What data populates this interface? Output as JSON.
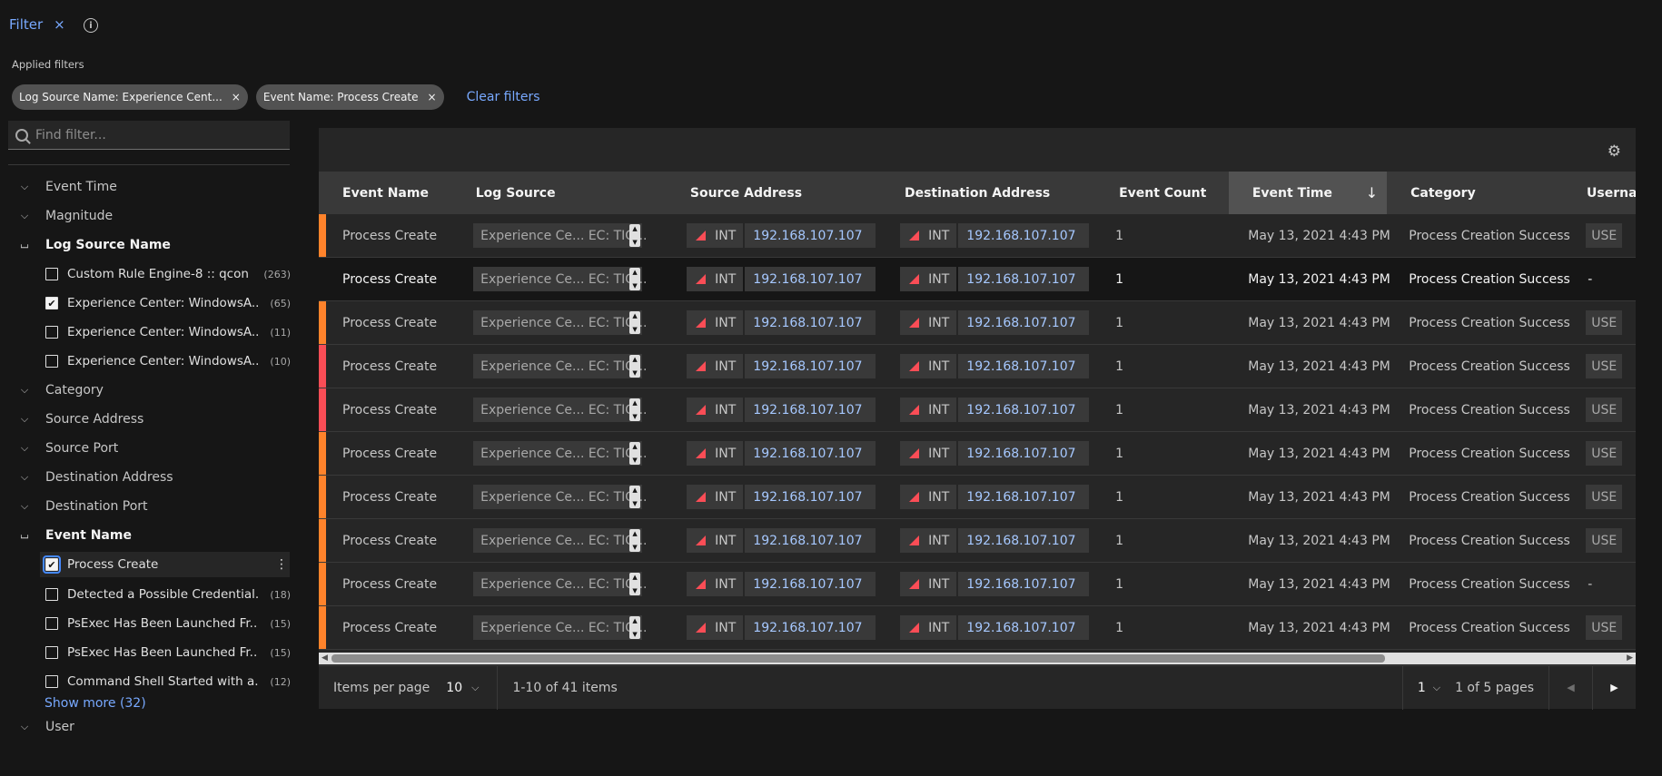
{
  "header": {
    "filter_label": "Filter",
    "close": "×",
    "info": "i"
  },
  "applied": {
    "label": "Applied filters",
    "chips": [
      {
        "label": "Log Source Name: Experience Cent..."
      },
      {
        "label": "Event Name: Process Create"
      }
    ],
    "clear_label": "Clear filters"
  },
  "sidebar": {
    "search_placeholder": "Find filter...",
    "groups": {
      "event_time": "Event Time",
      "magnitude": "Magnitude",
      "log_source_name": "Log Source Name",
      "category": "Category",
      "source_address": "Source Address",
      "source_port": "Source Port",
      "destination_address": "Destination Address",
      "destination_port": "Destination Port",
      "event_name": "Event Name",
      "user": "User"
    },
    "log_source_options": [
      {
        "label": "Custom Rule Engine-8 :: qcon",
        "count": "(263)",
        "checked": false
      },
      {
        "label": "Experience Center: WindowsA...",
        "count": "(65)",
        "checked": true
      },
      {
        "label": "Experience Center: WindowsA...",
        "count": "(11)",
        "checked": false
      },
      {
        "label": "Experience Center: WindowsA...",
        "count": "(10)",
        "checked": false
      }
    ],
    "event_name_options": [
      {
        "label": "Process Create",
        "count": "",
        "checked": true
      },
      {
        "label": "Detected a Possible Credential...",
        "count": "(18)",
        "checked": false
      },
      {
        "label": "PsExec Has Been Launched Fr...",
        "count": "(15)",
        "checked": false
      },
      {
        "label": "PsExec Has Been Launched Fr...",
        "count": "(15)",
        "checked": false
      },
      {
        "label": "Command Shell Started with a...",
        "count": "(12)",
        "checked": false
      }
    ],
    "show_more": "Show more (32)"
  },
  "table": {
    "columns": [
      "Event Name",
      "Log Source",
      "Source Address",
      "Destination Address",
      "Event Count",
      "Event Time",
      "Category",
      "Userna"
    ],
    "rows": [
      {
        "event_name": "Process Create",
        "log_source": "Experience Ce... EC: TIG...",
        "src_tag": "INT",
        "src_ip": "192.168.107.107",
        "dst_tag": "INT",
        "dst_ip": "192.168.107.107",
        "count": "1",
        "time": "May 13, 2021 4:43 PM",
        "category": "Process Creation Success",
        "user": "USE",
        "severity": "#ff832b"
      },
      {
        "event_name": "Process Create",
        "log_source": "Experience Ce... EC: TIG...",
        "src_tag": "INT",
        "src_ip": "192.168.107.107",
        "dst_tag": "INT",
        "dst_ip": "192.168.107.107",
        "count": "1",
        "time": "May 13, 2021 4:43 PM",
        "category": "Process Creation Success",
        "user": "-",
        "severity": "#161616"
      },
      {
        "event_name": "Process Create",
        "log_source": "Experience Ce... EC: TIG...",
        "src_tag": "INT",
        "src_ip": "192.168.107.107",
        "dst_tag": "INT",
        "dst_ip": "192.168.107.107",
        "count": "1",
        "time": "May 13, 2021 4:43 PM",
        "category": "Process Creation Success",
        "user": "USE",
        "severity": "#ff832b"
      },
      {
        "event_name": "Process Create",
        "log_source": "Experience Ce... EC: TIG...",
        "src_tag": "INT",
        "src_ip": "192.168.107.107",
        "dst_tag": "INT",
        "dst_ip": "192.168.107.107",
        "count": "1",
        "time": "May 13, 2021 4:43 PM",
        "category": "Process Creation Success",
        "user": "USE",
        "severity": "#fa4d56"
      },
      {
        "event_name": "Process Create",
        "log_source": "Experience Ce... EC: TIG...",
        "src_tag": "INT",
        "src_ip": "192.168.107.107",
        "dst_tag": "INT",
        "dst_ip": "192.168.107.107",
        "count": "1",
        "time": "May 13, 2021 4:43 PM",
        "category": "Process Creation Success",
        "user": "USE",
        "severity": "#fa4d56"
      },
      {
        "event_name": "Process Create",
        "log_source": "Experience Ce... EC: TIG...",
        "src_tag": "INT",
        "src_ip": "192.168.107.107",
        "dst_tag": "INT",
        "dst_ip": "192.168.107.107",
        "count": "1",
        "time": "May 13, 2021 4:43 PM",
        "category": "Process Creation Success",
        "user": "USE",
        "severity": "#ff832b"
      },
      {
        "event_name": "Process Create",
        "log_source": "Experience Ce... EC: TIG...",
        "src_tag": "INT",
        "src_ip": "192.168.107.107",
        "dst_tag": "INT",
        "dst_ip": "192.168.107.107",
        "count": "1",
        "time": "May 13, 2021 4:43 PM",
        "category": "Process Creation Success",
        "user": "USE",
        "severity": "#ff832b"
      },
      {
        "event_name": "Process Create",
        "log_source": "Experience Ce... EC: TIG...",
        "src_tag": "INT",
        "src_ip": "192.168.107.107",
        "dst_tag": "INT",
        "dst_ip": "192.168.107.107",
        "count": "1",
        "time": "May 13, 2021 4:43 PM",
        "category": "Process Creation Success",
        "user": "USE",
        "severity": "#ff832b"
      },
      {
        "event_name": "Process Create",
        "log_source": "Experience Ce... EC: TIG...",
        "src_tag": "INT",
        "src_ip": "192.168.107.107",
        "dst_tag": "INT",
        "dst_ip": "192.168.107.107",
        "count": "1",
        "time": "May 13, 2021 4:43 PM",
        "category": "Process Creation Success",
        "user": "-",
        "severity": "#ff832b"
      },
      {
        "event_name": "Process Create",
        "log_source": "Experience Ce... EC: TIG...",
        "src_tag": "INT",
        "src_ip": "192.168.107.107",
        "dst_tag": "INT",
        "dst_ip": "192.168.107.107",
        "count": "1",
        "time": "May 13, 2021 4:43 PM",
        "category": "Process Creation Success",
        "user": "USE",
        "severity": "#ff832b"
      }
    ]
  },
  "pagination": {
    "items_per_page_label": "Items per page",
    "items_per_page": "10",
    "range": "1-10 of 41 items",
    "page": "1",
    "of_pages": "1 of 5 pages"
  },
  "colors": {
    "accent": "#78a9ff",
    "orange": "#ff832b",
    "red": "#fa4d56",
    "link_ip": "#a6c8ff"
  },
  "icons": {
    "sort": "arrow-down-icon",
    "settings": "gear-icon",
    "prev": "caret-left-icon",
    "next": "caret-right-icon"
  }
}
